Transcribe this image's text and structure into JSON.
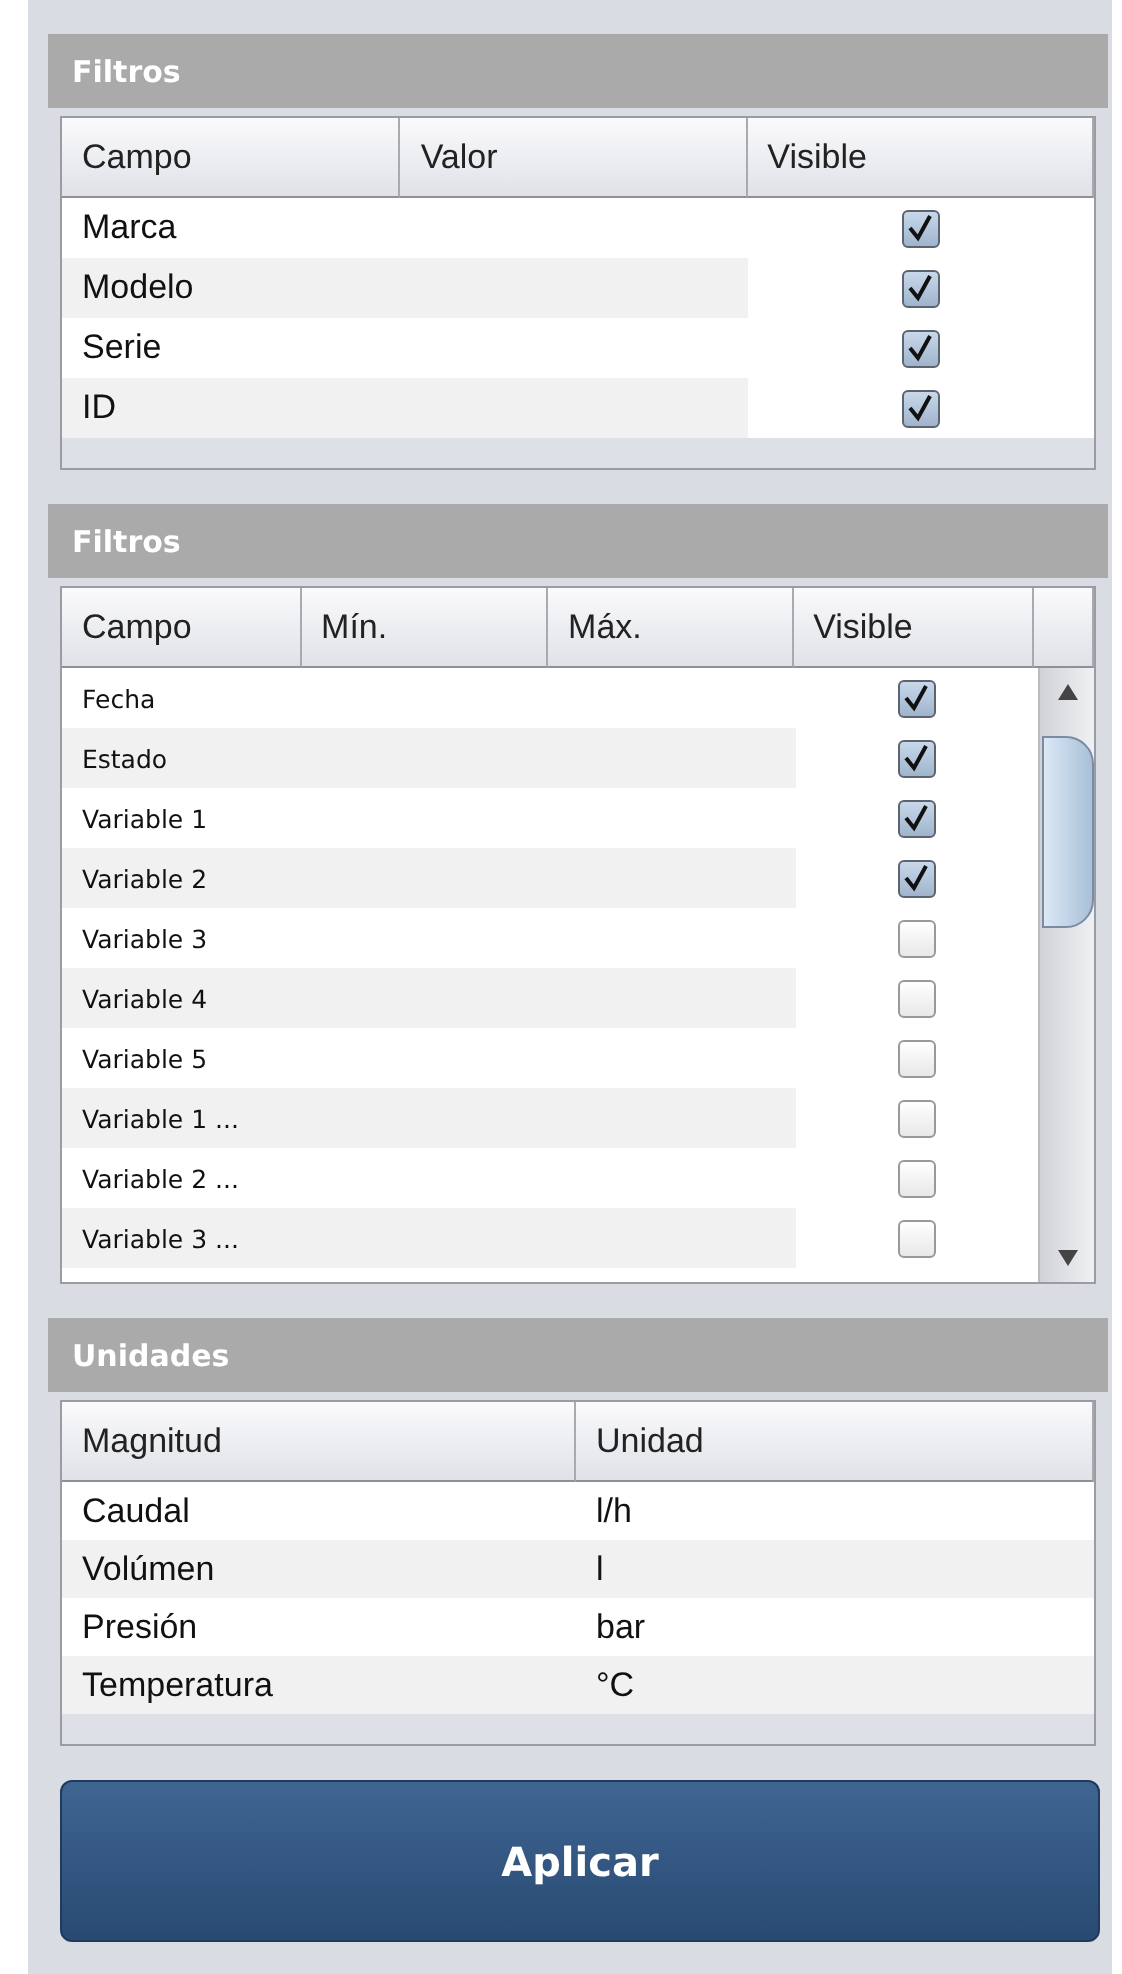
{
  "sections": [
    {
      "title": "Filtros",
      "kind": "filter",
      "columns": [
        "Campo",
        "Valor",
        "Visible"
      ],
      "rows": [
        {
          "campo": "Marca",
          "visible": true
        },
        {
          "campo": "Modelo",
          "visible": true
        },
        {
          "campo": "Serie",
          "visible": true
        },
        {
          "campo": "ID",
          "visible": true
        }
      ]
    },
    {
      "title": "Filtros",
      "kind": "range",
      "columns": [
        "Campo",
        "Mín.",
        "Máx.",
        "Visible"
      ],
      "rows": [
        {
          "campo": "Fecha",
          "visible": true
        },
        {
          "campo": "Estado",
          "visible": true
        },
        {
          "campo": "Variable 1",
          "visible": true
        },
        {
          "campo": "Variable 2",
          "visible": true
        },
        {
          "campo": "Variable 3",
          "visible": false
        },
        {
          "campo": "Variable 4",
          "visible": false
        },
        {
          "campo": "Variable 5",
          "visible": false
        },
        {
          "campo": "Variable 1 ...",
          "visible": false
        },
        {
          "campo": "Variable 2 ...",
          "visible": false
        },
        {
          "campo": "Variable 3 ...",
          "visible": false
        }
      ]
    },
    {
      "title": "Unidades",
      "kind": "units",
      "columns": [
        "Magnitud",
        "Unidad"
      ],
      "rows": [
        {
          "magnitud": "Caudal",
          "unidad": "l/h"
        },
        {
          "magnitud": "Volúmen",
          "unidad": "l"
        },
        {
          "magnitud": "Presión",
          "unidad": "bar"
        },
        {
          "magnitud": "Temperatura",
          "unidad": "°C"
        }
      ]
    }
  ],
  "apply_button": "Aplicar"
}
